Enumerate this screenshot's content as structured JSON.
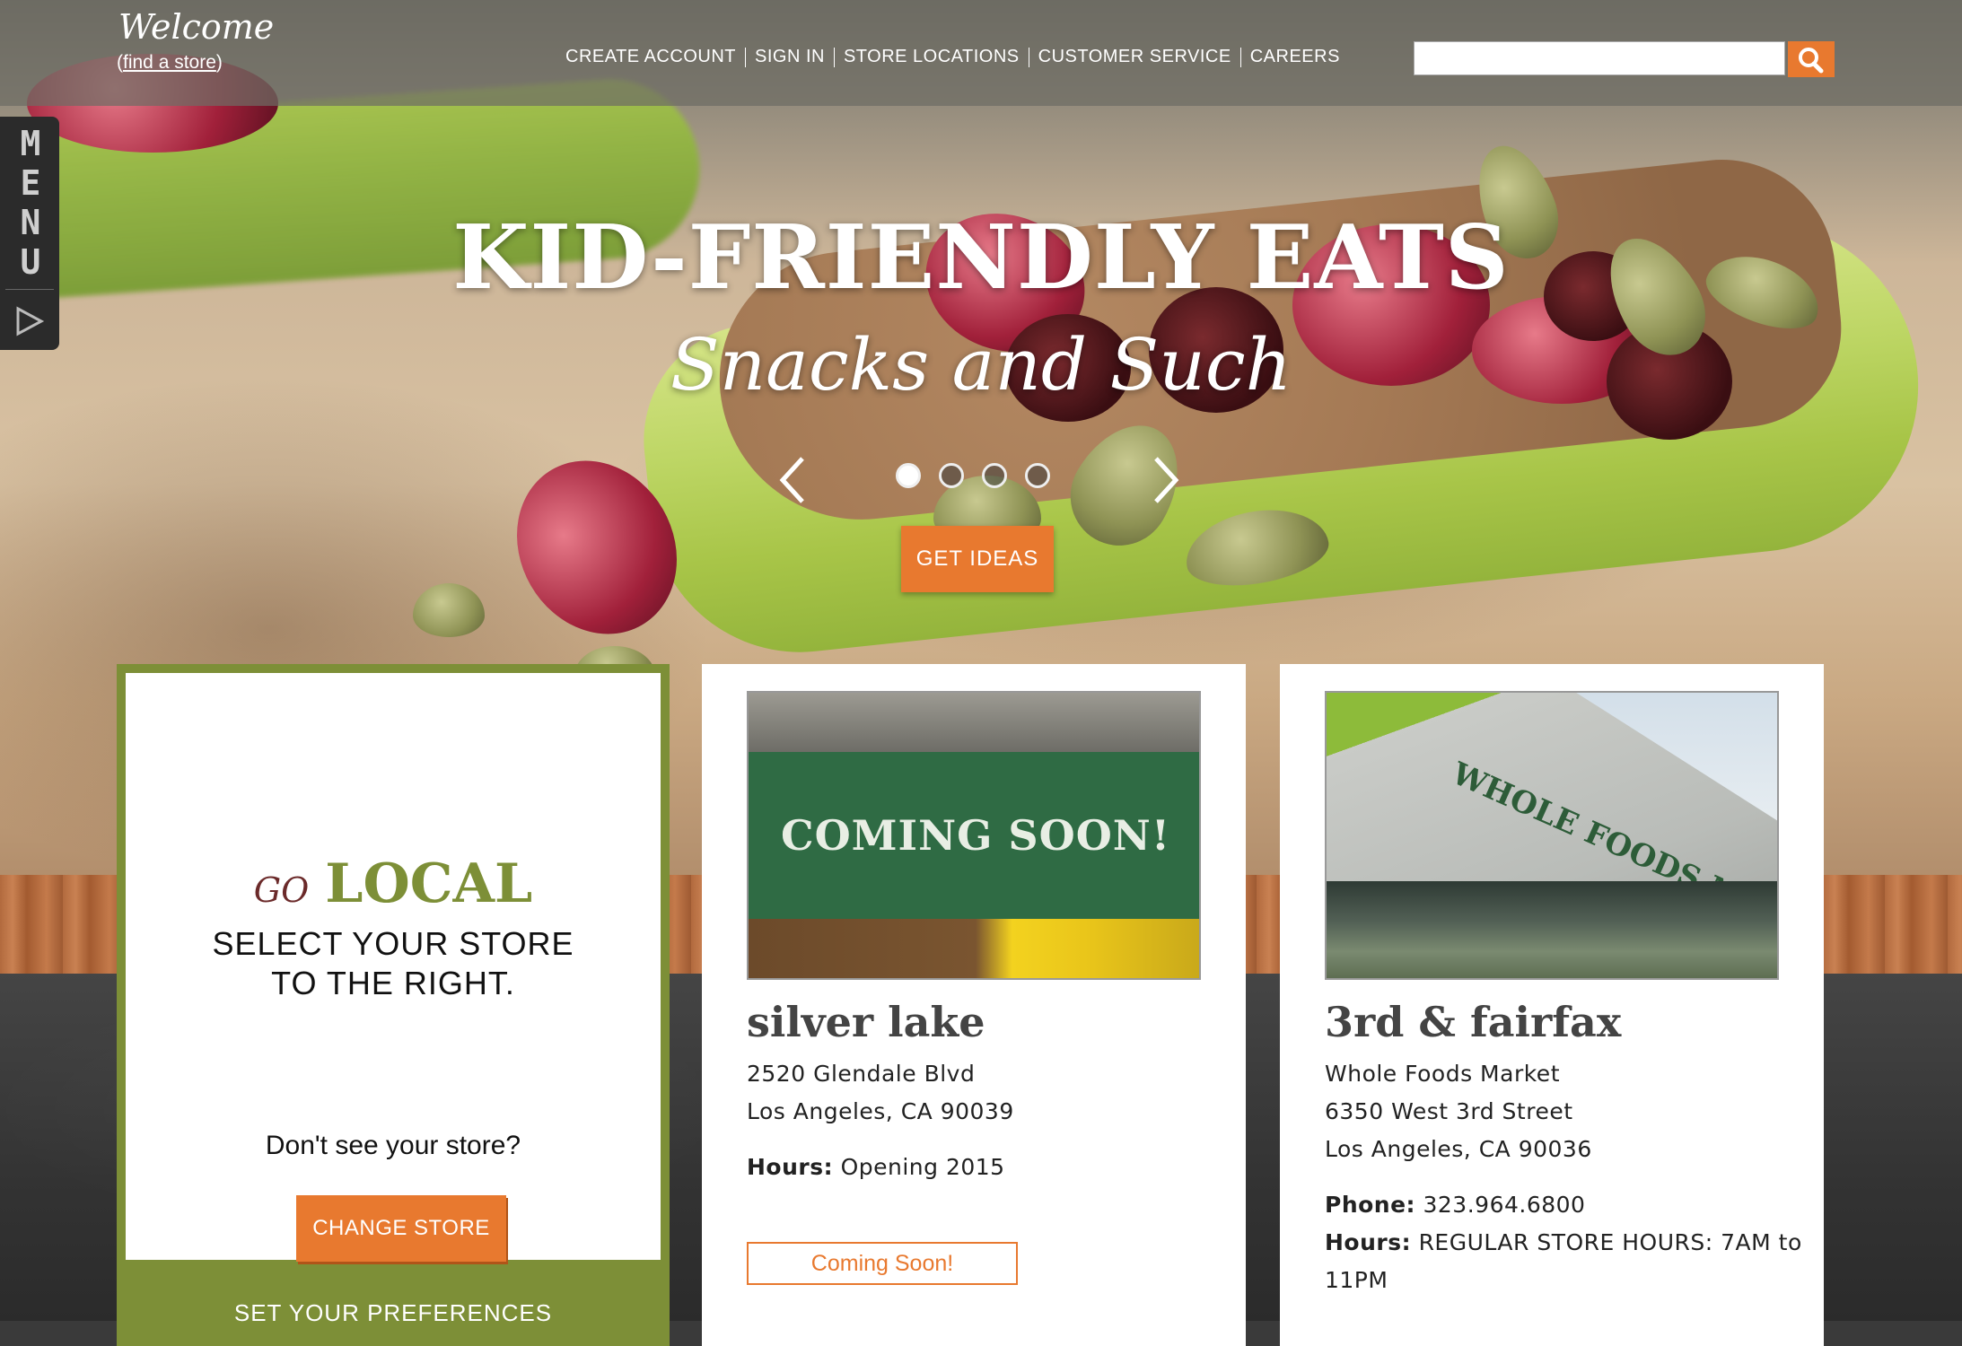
{
  "header": {
    "welcome": "Welcome",
    "find_store_open": "(",
    "find_store_link": "find a store",
    "find_store_close": ")",
    "nav": [
      "CREATE ACCOUNT",
      "SIGN IN",
      "STORE LOCATIONS",
      "CUSTOMER SERVICE",
      "CAREERS"
    ],
    "search": {
      "value": "",
      "placeholder": "",
      "icon": "search-icon"
    }
  },
  "side_menu": {
    "letters": [
      "M",
      "E",
      "N",
      "U"
    ],
    "icon": "play-arrow-icon"
  },
  "hero": {
    "title": "KID-FRIENDLY EATS",
    "subtitle": "Snacks and Such",
    "slides_total": 4,
    "active_slide": 1,
    "cta": "GET IDEAS"
  },
  "local_card": {
    "go": "GO",
    "local": "LOCAL",
    "select_line1": "SELECT YOUR STORE",
    "select_line2": "TO THE RIGHT.",
    "dont_see": "Don't see your store?",
    "change_store": "CHANGE STORE",
    "set_prefs": "SET YOUR PREFERENCES"
  },
  "stores": [
    {
      "name": "silver lake",
      "image_text": "COMING SOON!",
      "address_line1": "2520 Glendale Blvd",
      "address_line2": "Los Angeles, CA 90039",
      "hours_label": "Hours:",
      "hours": "Opening 2015",
      "button": "Coming Soon!"
    },
    {
      "name": "3rd & fairfax",
      "image_text": "WHOLE FOODS MARKET",
      "address_line1": "Whole Foods Market",
      "address_line2": "6350 West 3rd Street",
      "address_line3": "Los Angeles, CA 90036",
      "phone_label": "Phone:",
      "phone": "323.964.6800",
      "hours_label": "Hours:",
      "hours_line1": "REGULAR STORE HOURS: 7AM to",
      "hours_line2": "11PM"
    }
  ],
  "colors": {
    "accent": "#e8792f",
    "brand_green": "#7d8f37",
    "dark_text": "#444444"
  }
}
